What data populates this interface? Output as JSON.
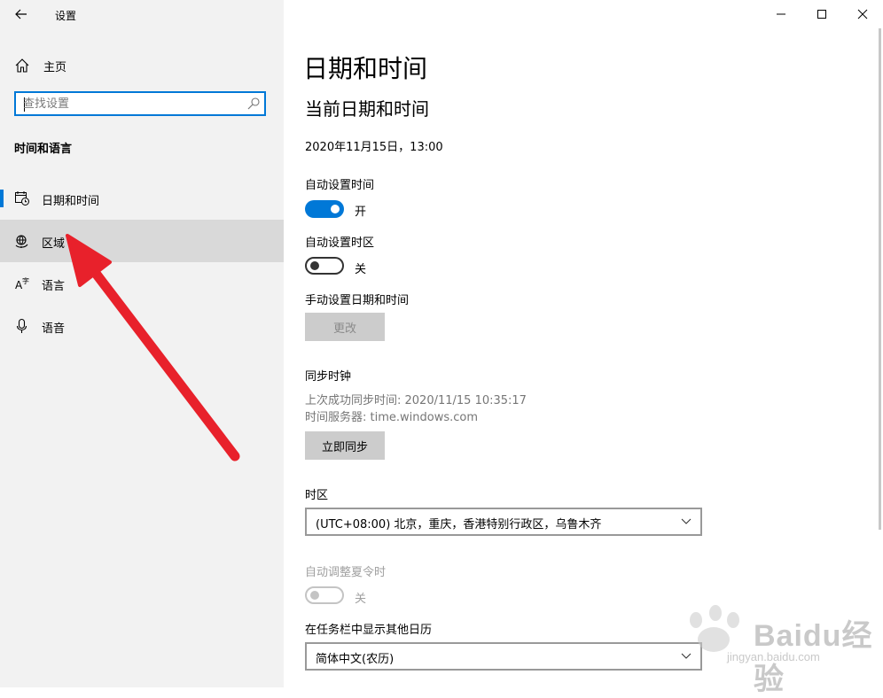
{
  "window": {
    "title": "设置",
    "controls": [
      "minimize",
      "maximize",
      "close"
    ]
  },
  "sidebar": {
    "home_label": "主页",
    "search_placeholder": "查找设置",
    "section_title": "时间和语言",
    "items": [
      {
        "label": "日期和时间",
        "icon": "calendar-clock-icon",
        "selected": true
      },
      {
        "label": "区域",
        "icon": "globe-icon",
        "hovered": true
      },
      {
        "label": "语言",
        "icon": "language-icon"
      },
      {
        "label": "语音",
        "icon": "microphone-icon"
      }
    ]
  },
  "main": {
    "page_title": "日期和时间",
    "current_heading": "当前日期和时间",
    "current_value": "2020年11月15日，13:00",
    "auto_time": {
      "label": "自动设置时间",
      "state": "开",
      "on": true
    },
    "auto_timezone": {
      "label": "自动设置时区",
      "state": "关",
      "on": false
    },
    "manual": {
      "label": "手动设置日期和时间",
      "button": "更改"
    },
    "sync": {
      "label": "同步时钟",
      "last_sync": "上次成功同步时间: 2020/11/15 10:35:17",
      "server": "时间服务器: time.windows.com",
      "button": "立即同步"
    },
    "timezone": {
      "label": "时区",
      "value": "(UTC+08:00) 北京，重庆，香港特别行政区，乌鲁木齐"
    },
    "dst": {
      "label": "自动调整夏令时",
      "state": "关",
      "on": false
    },
    "taskbar_calendar": {
      "label": "在任务栏中显示其他日历",
      "value": "简体中文(农历)"
    }
  },
  "colors": {
    "accent": "#0078d7",
    "sidebar_bg": "#f2f2f2",
    "annotation_arrow": "#e8212b"
  },
  "watermark": {
    "brand": "Baidu经验",
    "url": "jingyan.baidu.com"
  }
}
